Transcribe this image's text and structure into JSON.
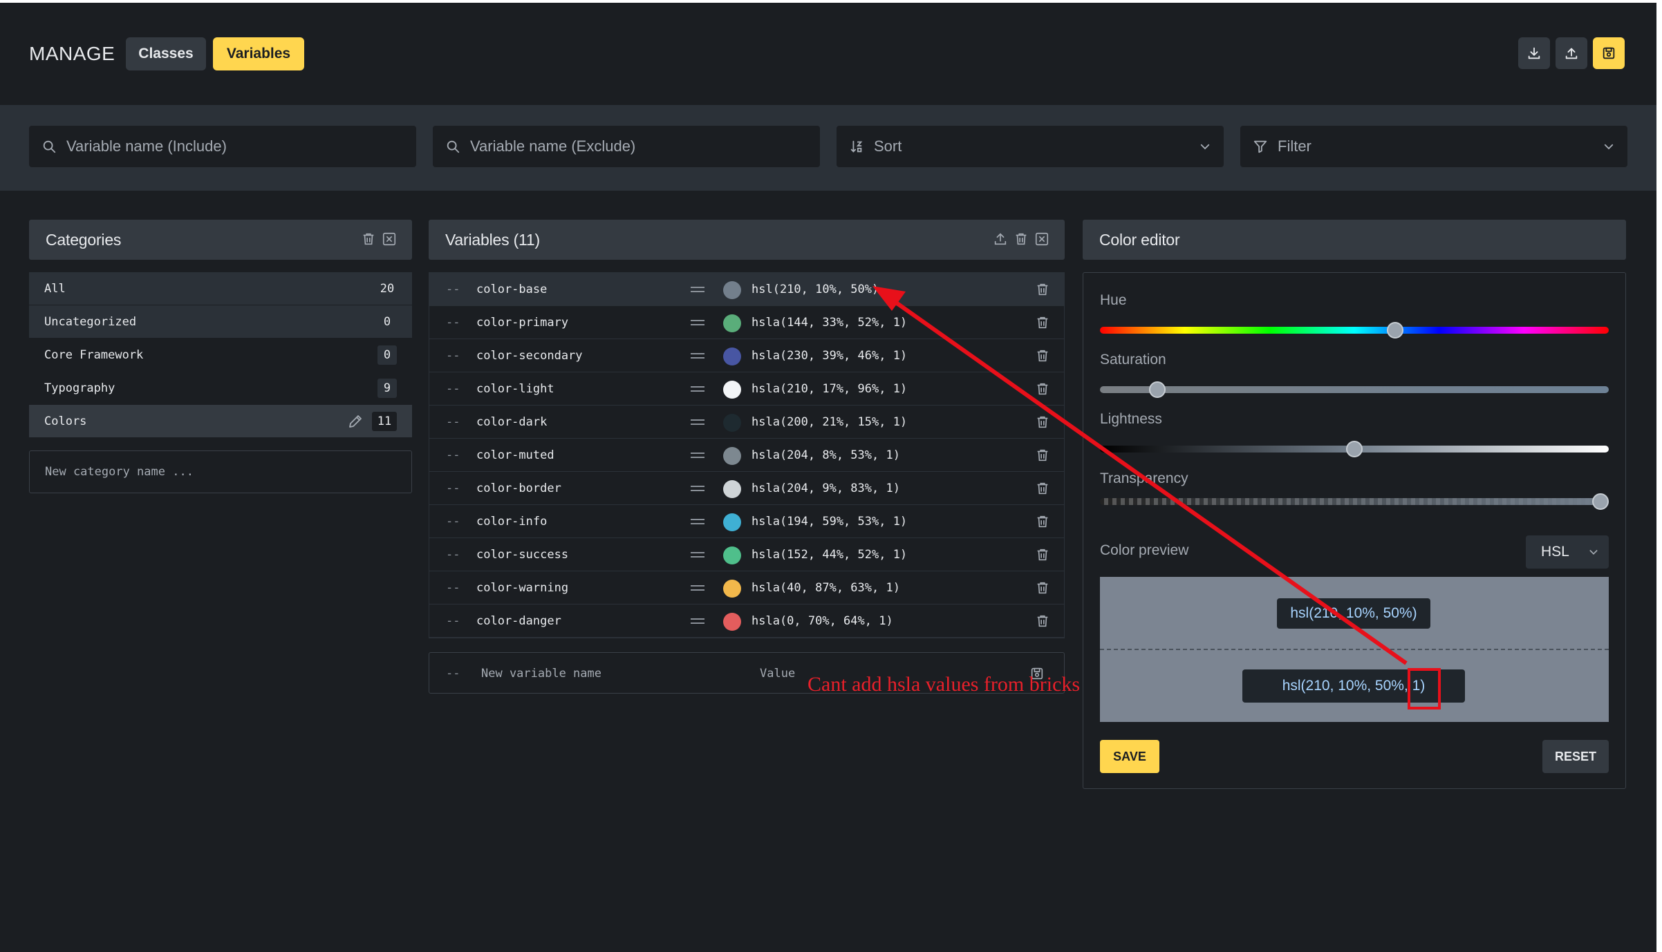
{
  "header": {
    "brand": "MANAGE",
    "tabs": {
      "classes": "Classes",
      "variables": "Variables"
    },
    "icons": [
      "download-icon",
      "upload-icon",
      "save-icon"
    ]
  },
  "filters": {
    "include_placeholder": "Variable name (Include)",
    "exclude_placeholder": "Variable name (Exclude)",
    "sort_label": "Sort",
    "filter_label": "Filter"
  },
  "categories": {
    "title": "Categories",
    "items": [
      {
        "name": "All",
        "count": "20"
      },
      {
        "name": "Uncategorized",
        "count": "0"
      },
      {
        "name": "Core Framework",
        "count": "0"
      },
      {
        "name": "Typography",
        "count": "9"
      },
      {
        "name": "Colors",
        "count": "11"
      }
    ],
    "new_placeholder": "New category name ..."
  },
  "variables": {
    "title": "Variables (11)",
    "prefix": "--",
    "items": [
      {
        "name": "color-base",
        "value": "hsl(210, 10%, 50%)",
        "swatch": "#737f8c"
      },
      {
        "name": "color-primary",
        "value": "hsla(144, 33%, 52%, 1)",
        "swatch": "#5aad7a"
      },
      {
        "name": "color-secondary",
        "value": "hsla(230, 39%, 46%, 1)",
        "swatch": "#4856a3"
      },
      {
        "name": "color-light",
        "value": "hsla(210, 17%, 96%, 1)",
        "swatch": "#f3f5f7"
      },
      {
        "name": "color-dark",
        "value": "hsla(200, 21%, 15%, 1)",
        "swatch": "#1e2a30"
      },
      {
        "name": "color-muted",
        "value": "hsla(204, 8%, 53%, 1)",
        "swatch": "#7d8890"
      },
      {
        "name": "color-border",
        "value": "hsla(204, 9%, 83%, 1)",
        "swatch": "#cfd4d7"
      },
      {
        "name": "color-info",
        "value": "hsla(194, 59%, 53%, 1)",
        "swatch": "#3fb0d4"
      },
      {
        "name": "color-success",
        "value": "hsla(152, 44%, 52%, 1)",
        "swatch": "#4fbf8b"
      },
      {
        "name": "color-warning",
        "value": "hsla(40, 87%, 63%, 1)",
        "swatch": "#f2b84b"
      },
      {
        "name": "color-danger",
        "value": "hsla(0, 70%, 64%, 1)",
        "swatch": "#e35d5d"
      }
    ],
    "new_name_placeholder": "New variable name",
    "new_value_placeholder": "Value"
  },
  "editor": {
    "title": "Color editor",
    "hue_label": "Hue",
    "hue_value": 210,
    "saturation_label": "Saturation",
    "saturation_value": 0.1,
    "lightness_label": "Lightness",
    "lightness_value": 0.5,
    "transparency_label": "Transparency",
    "transparency_value": 1,
    "preview_label": "Color preview",
    "format": "HSL",
    "preview_top": "hsl(210, 10%, 50%)",
    "preview_bottom": "hsl(210, 10%, 50%, 1)",
    "save": "SAVE",
    "reset": "RESET"
  },
  "annotation": {
    "text": "Cant add hsla values from bricks",
    "color": "#e8202a"
  },
  "colors": {
    "accent": "#ffd64f",
    "background": "#1b1e22",
    "panel": "#343a41"
  }
}
